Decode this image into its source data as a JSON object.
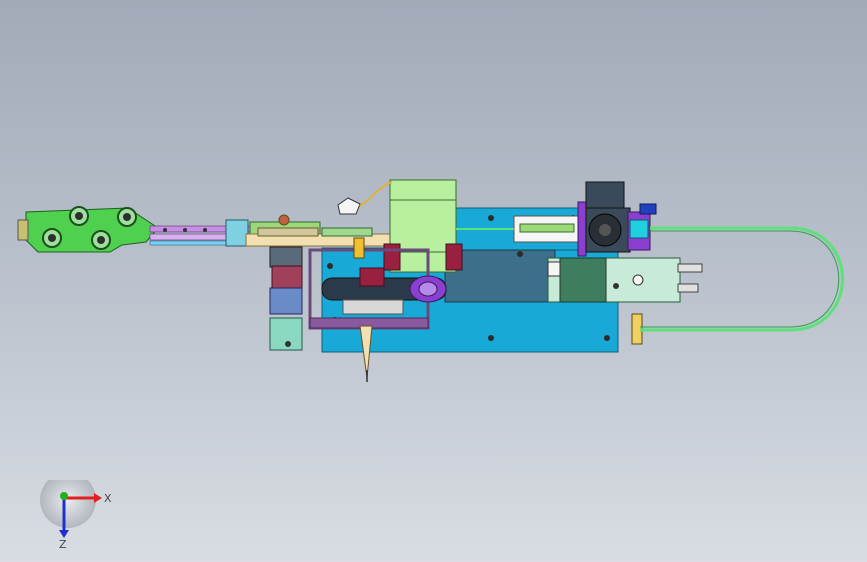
{
  "viewport": {
    "background_top": "#a1aab8",
    "background_bottom": "#d9dde3"
  },
  "triad": {
    "x_label": "X",
    "z_label": "Z",
    "x_color": "#e02020",
    "y_color": "#20b020",
    "z_color": "#2030d0"
  },
  "model": {
    "colors": {
      "plate_blue": "#19a9d6",
      "motor_green": "#b9f0a0",
      "feeder_green": "#4fd04f",
      "purple": "#8a3fd0",
      "beige": "#f3e0b0",
      "maroon": "#9a2040",
      "dark_slate": "#3a4a5a",
      "tube_green": "#5fe07a"
    }
  }
}
